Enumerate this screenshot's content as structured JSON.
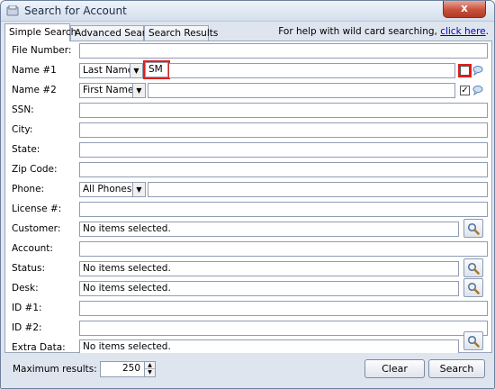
{
  "window": {
    "title": "Search for Account",
    "close_glyph": "x"
  },
  "tabs": [
    {
      "label": "Simple Search",
      "active": true
    },
    {
      "label": "Advanced Search",
      "active": false
    },
    {
      "label": "Search Results",
      "active": false
    }
  ],
  "help": {
    "prefix": "For help with wild card searching, ",
    "link": "click here",
    "suffix": "."
  },
  "form": {
    "file_number": {
      "label": "File Number:",
      "value": ""
    },
    "name1": {
      "label": "Name #1",
      "type": "Last Name",
      "value": "SM",
      "checked": false
    },
    "name2": {
      "label": "Name #2",
      "type": "First Name",
      "value": "",
      "checked": true
    },
    "ssn": {
      "label": "SSN:",
      "value": ""
    },
    "city": {
      "label": "City:",
      "value": ""
    },
    "state": {
      "label": "State:",
      "value": ""
    },
    "zip": {
      "label": "Zip Code:",
      "value": ""
    },
    "phone": {
      "label": "Phone:",
      "type": "All Phones",
      "value": ""
    },
    "license": {
      "label": "License #:",
      "value": ""
    },
    "customer": {
      "label": "Customer:",
      "value": "No items selected."
    },
    "account": {
      "label": "Account:",
      "value": ""
    },
    "status": {
      "label": "Status:",
      "value": "No items selected."
    },
    "desk": {
      "label": "Desk:",
      "value": "No items selected."
    },
    "id1": {
      "label": "ID #1:",
      "value": ""
    },
    "id2": {
      "label": "ID #2:",
      "value": ""
    },
    "extra": {
      "label": "Extra Data:",
      "value": "No items selected."
    }
  },
  "footer": {
    "max_label": "Maximum results:",
    "max_value": "250",
    "clear_label": "Clear",
    "search_label": "Search"
  },
  "icons": {
    "search": "magnifier-icon",
    "info": "speech-bubble-icon",
    "dropdown": "chevron-down-icon"
  },
  "colors": {
    "highlight": "#e31d1d",
    "link": "#0000cc"
  }
}
